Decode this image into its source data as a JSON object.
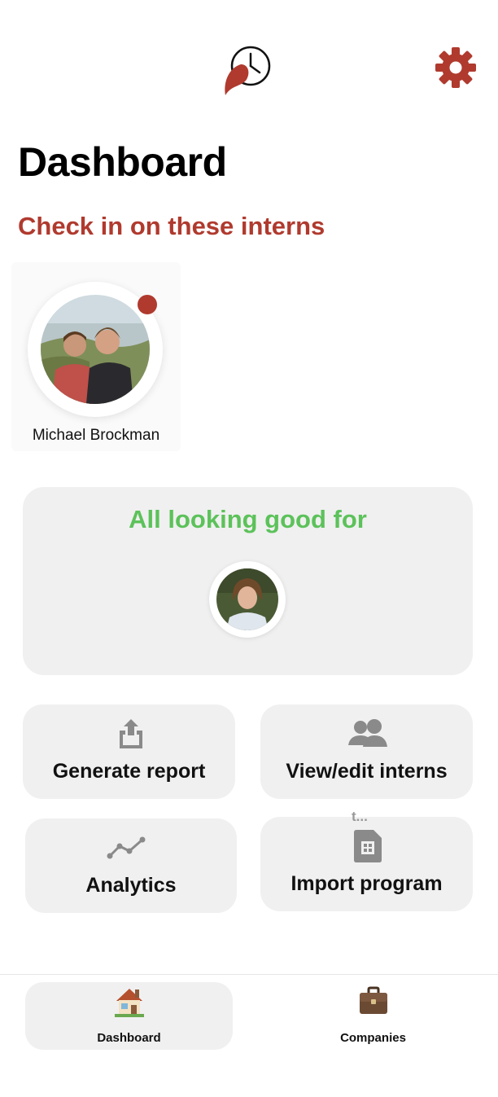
{
  "header": {
    "logo_icon": "red-pin-clock-logo",
    "settings_icon": "gear-icon",
    "accent_color": "#b03a2e"
  },
  "page": {
    "title": "Dashboard",
    "section_title": "Check in on these interns"
  },
  "check_in_interns": [
    {
      "name": "Michael Brockman",
      "status": "needs-attention",
      "status_color": "#b03a2e"
    }
  ],
  "looking_good": {
    "title": "All looking good for",
    "title_color": "#5cc25a"
  },
  "actions": [
    {
      "label": "Generate report",
      "icon": "share-upload-icon"
    },
    {
      "label": "View/edit interns",
      "icon": "people-icon"
    },
    {
      "label": "Analytics",
      "icon": "line-chart-icon"
    },
    {
      "label": "Import program",
      "icon": "spreadsheet-file-icon"
    }
  ],
  "tooltip_hint": "t...",
  "tabbar": {
    "tabs": [
      {
        "label": "Dashboard",
        "icon": "house-icon",
        "active": true
      },
      {
        "label": "Companies",
        "icon": "briefcase-icon",
        "active": false
      }
    ]
  }
}
